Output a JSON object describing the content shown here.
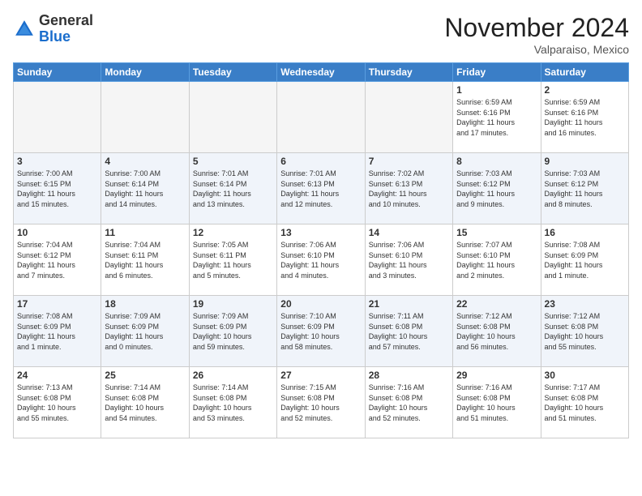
{
  "header": {
    "logo_general": "General",
    "logo_blue": "Blue",
    "month_title": "November 2024",
    "location": "Valparaiso, Mexico"
  },
  "weekdays": [
    "Sunday",
    "Monday",
    "Tuesday",
    "Wednesday",
    "Thursday",
    "Friday",
    "Saturday"
  ],
  "weeks": [
    [
      {
        "day": "",
        "info": ""
      },
      {
        "day": "",
        "info": ""
      },
      {
        "day": "",
        "info": ""
      },
      {
        "day": "",
        "info": ""
      },
      {
        "day": "",
        "info": ""
      },
      {
        "day": "1",
        "info": "Sunrise: 6:59 AM\nSunset: 6:16 PM\nDaylight: 11 hours\nand 17 minutes."
      },
      {
        "day": "2",
        "info": "Sunrise: 6:59 AM\nSunset: 6:16 PM\nDaylight: 11 hours\nand 16 minutes."
      }
    ],
    [
      {
        "day": "3",
        "info": "Sunrise: 7:00 AM\nSunset: 6:15 PM\nDaylight: 11 hours\nand 15 minutes."
      },
      {
        "day": "4",
        "info": "Sunrise: 7:00 AM\nSunset: 6:14 PM\nDaylight: 11 hours\nand 14 minutes."
      },
      {
        "day": "5",
        "info": "Sunrise: 7:01 AM\nSunset: 6:14 PM\nDaylight: 11 hours\nand 13 minutes."
      },
      {
        "day": "6",
        "info": "Sunrise: 7:01 AM\nSunset: 6:13 PM\nDaylight: 11 hours\nand 12 minutes."
      },
      {
        "day": "7",
        "info": "Sunrise: 7:02 AM\nSunset: 6:13 PM\nDaylight: 11 hours\nand 10 minutes."
      },
      {
        "day": "8",
        "info": "Sunrise: 7:03 AM\nSunset: 6:12 PM\nDaylight: 11 hours\nand 9 minutes."
      },
      {
        "day": "9",
        "info": "Sunrise: 7:03 AM\nSunset: 6:12 PM\nDaylight: 11 hours\nand 8 minutes."
      }
    ],
    [
      {
        "day": "10",
        "info": "Sunrise: 7:04 AM\nSunset: 6:12 PM\nDaylight: 11 hours\nand 7 minutes."
      },
      {
        "day": "11",
        "info": "Sunrise: 7:04 AM\nSunset: 6:11 PM\nDaylight: 11 hours\nand 6 minutes."
      },
      {
        "day": "12",
        "info": "Sunrise: 7:05 AM\nSunset: 6:11 PM\nDaylight: 11 hours\nand 5 minutes."
      },
      {
        "day": "13",
        "info": "Sunrise: 7:06 AM\nSunset: 6:10 PM\nDaylight: 11 hours\nand 4 minutes."
      },
      {
        "day": "14",
        "info": "Sunrise: 7:06 AM\nSunset: 6:10 PM\nDaylight: 11 hours\nand 3 minutes."
      },
      {
        "day": "15",
        "info": "Sunrise: 7:07 AM\nSunset: 6:10 PM\nDaylight: 11 hours\nand 2 minutes."
      },
      {
        "day": "16",
        "info": "Sunrise: 7:08 AM\nSunset: 6:09 PM\nDaylight: 11 hours\nand 1 minute."
      }
    ],
    [
      {
        "day": "17",
        "info": "Sunrise: 7:08 AM\nSunset: 6:09 PM\nDaylight: 11 hours\nand 1 minute."
      },
      {
        "day": "18",
        "info": "Sunrise: 7:09 AM\nSunset: 6:09 PM\nDaylight: 11 hours\nand 0 minutes."
      },
      {
        "day": "19",
        "info": "Sunrise: 7:09 AM\nSunset: 6:09 PM\nDaylight: 10 hours\nand 59 minutes."
      },
      {
        "day": "20",
        "info": "Sunrise: 7:10 AM\nSunset: 6:09 PM\nDaylight: 10 hours\nand 58 minutes."
      },
      {
        "day": "21",
        "info": "Sunrise: 7:11 AM\nSunset: 6:08 PM\nDaylight: 10 hours\nand 57 minutes."
      },
      {
        "day": "22",
        "info": "Sunrise: 7:12 AM\nSunset: 6:08 PM\nDaylight: 10 hours\nand 56 minutes."
      },
      {
        "day": "23",
        "info": "Sunrise: 7:12 AM\nSunset: 6:08 PM\nDaylight: 10 hours\nand 55 minutes."
      }
    ],
    [
      {
        "day": "24",
        "info": "Sunrise: 7:13 AM\nSunset: 6:08 PM\nDaylight: 10 hours\nand 55 minutes."
      },
      {
        "day": "25",
        "info": "Sunrise: 7:14 AM\nSunset: 6:08 PM\nDaylight: 10 hours\nand 54 minutes."
      },
      {
        "day": "26",
        "info": "Sunrise: 7:14 AM\nSunset: 6:08 PM\nDaylight: 10 hours\nand 53 minutes."
      },
      {
        "day": "27",
        "info": "Sunrise: 7:15 AM\nSunset: 6:08 PM\nDaylight: 10 hours\nand 52 minutes."
      },
      {
        "day": "28",
        "info": "Sunrise: 7:16 AM\nSunset: 6:08 PM\nDaylight: 10 hours\nand 52 minutes."
      },
      {
        "day": "29",
        "info": "Sunrise: 7:16 AM\nSunset: 6:08 PM\nDaylight: 10 hours\nand 51 minutes."
      },
      {
        "day": "30",
        "info": "Sunrise: 7:17 AM\nSunset: 6:08 PM\nDaylight: 10 hours\nand 51 minutes."
      }
    ]
  ]
}
